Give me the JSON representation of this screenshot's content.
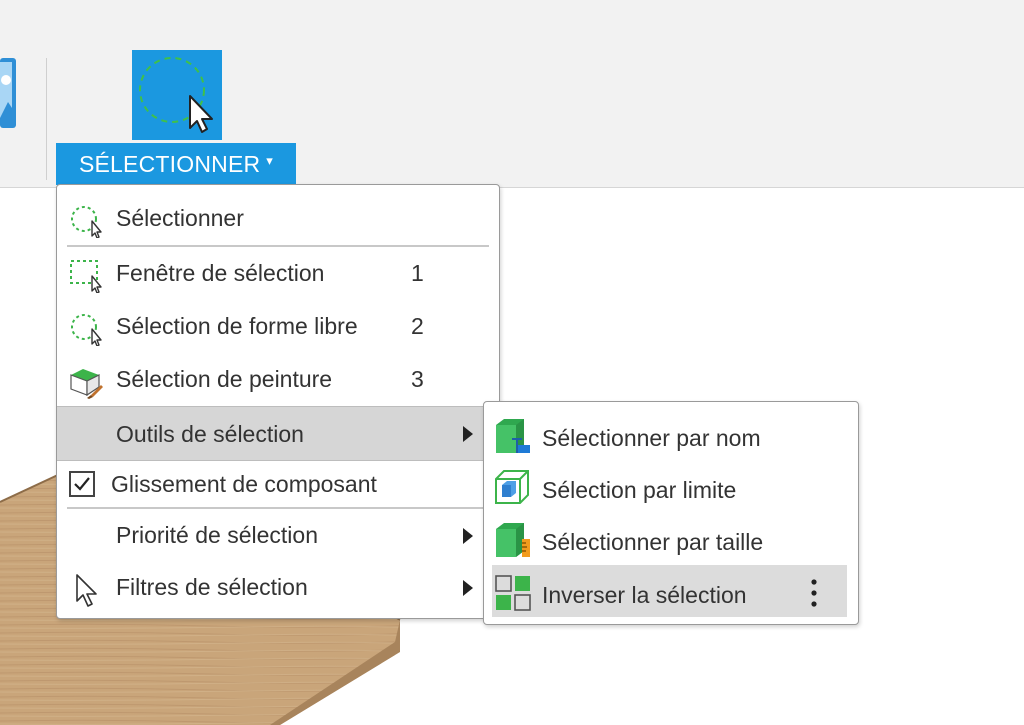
{
  "toolbar": {
    "select_button_label": "SÉLECTIONNER",
    "select_button_caret": "▾",
    "select_icon": "freeform-selection-cursor-icon"
  },
  "select_menu": {
    "items": [
      {
        "label": "Sélectionner",
        "icon": "freeform-select-icon",
        "shortcut": ""
      },
      {
        "label": "Fenêtre de sélection",
        "icon": "window-select-icon",
        "shortcut": "1"
      },
      {
        "label": "Sélection de forme libre",
        "icon": "freeform-select-icon",
        "shortcut": "2"
      },
      {
        "label": "Sélection de peinture",
        "icon": "paint-select-icon",
        "shortcut": "3"
      },
      {
        "label": "Outils de sélection",
        "icon": "",
        "has_submenu": true,
        "highlighted": true
      },
      {
        "label": "Glissement de composant",
        "icon": "checkbox-checked-icon",
        "checked": true
      },
      {
        "label": "Priorité de sélection",
        "icon": "",
        "has_submenu": true
      },
      {
        "label": "Filtres de sélection",
        "icon": "cursor-arrow-icon",
        "has_submenu": true
      }
    ]
  },
  "selection_tools_submenu": {
    "items": [
      {
        "label": "Sélectionner par nom",
        "icon": "select-by-name-icon"
      },
      {
        "label": "Sélection par limite",
        "icon": "select-by-boundary-icon"
      },
      {
        "label": "Sélectionner par taille",
        "icon": "select-by-size-icon"
      },
      {
        "label": "Inverser la sélection",
        "icon": "invert-selection-icon",
        "highlighted": true
      }
    ],
    "more_options_icon": "vertical-ellipsis-icon"
  },
  "colors": {
    "accent": "#1b98e0",
    "highlight": "#d6d6d6",
    "toolbar_bg": "#f2f2f2",
    "icon_green": "#3cb44a",
    "wood": "#c9a57a"
  }
}
